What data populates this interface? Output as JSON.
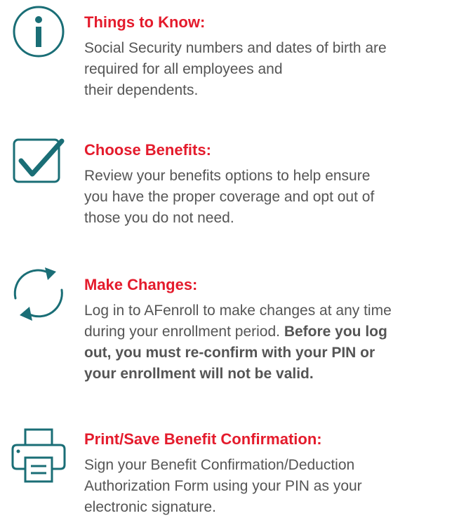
{
  "colors": {
    "accent_teal": "#1a6e76",
    "heading_red": "#e41b2c",
    "body_gray": "#555555"
  },
  "sections": [
    {
      "icon": "info-icon",
      "heading": "Things to Know:",
      "lines": [
        "Social Security numbers and dates of birth are",
        "required for all employees and",
        "their dependents."
      ]
    },
    {
      "icon": "checkbox-check-icon",
      "heading": "Choose Benefits:",
      "lines": [
        "Review your benefits options to help ensure",
        "you have the proper coverage and opt out of",
        "those you do not need."
      ]
    },
    {
      "icon": "refresh-cycle-icon",
      "heading": "Make Changes:",
      "line1": "Log in to AFenroll to make changes at any time",
      "line2_regular": "during your enrollment period. ",
      "line2_bold": "Before you log",
      "line3_bold": "out, you must re-confirm with your PIN or",
      "line4_bold": "your enrollment will not be valid."
    },
    {
      "icon": "printer-icon",
      "heading": "Print/Save Benefit Confirmation:",
      "lines": [
        "Sign your Benefit Confirmation/Deduction",
        "Authorization Form using your PIN as your",
        "electronic signature."
      ]
    }
  ]
}
